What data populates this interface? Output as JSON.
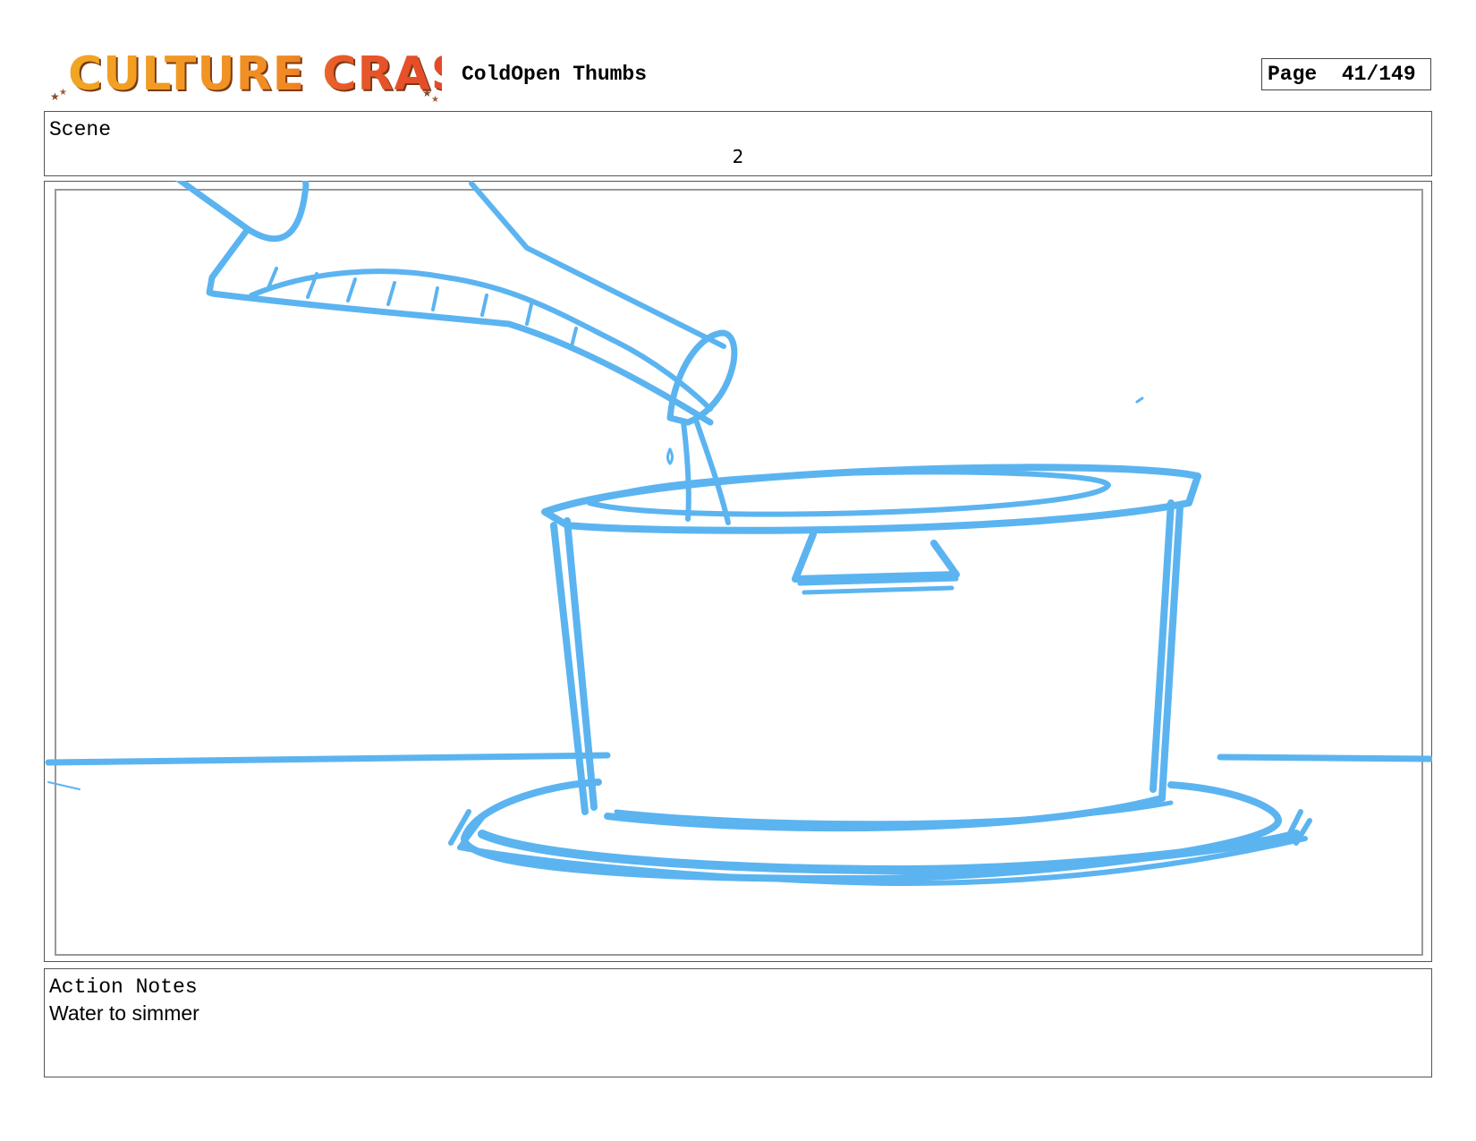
{
  "header": {
    "logo_text": "CULTURE CRASH",
    "doc_title": "ColdOpen Thumbs",
    "page_label": "Page",
    "page_number": "41/149"
  },
  "scene": {
    "label": "Scene",
    "number": "2"
  },
  "panel": {
    "sketch_color": "#5bb4f0",
    "border_color": "#999999"
  },
  "notes": {
    "label": "Action Notes",
    "text": "Water to simmer"
  }
}
